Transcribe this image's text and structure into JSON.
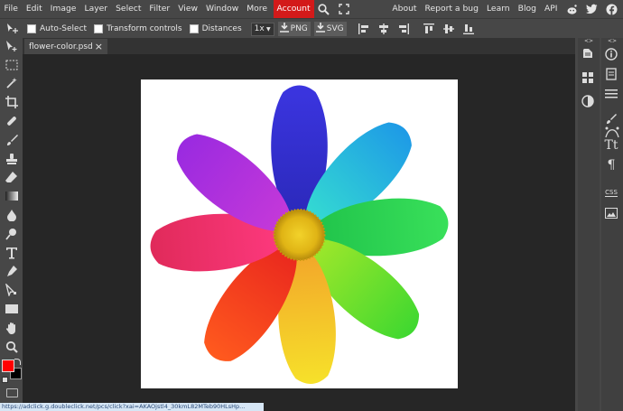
{
  "menu": {
    "items": [
      "File",
      "Edit",
      "Image",
      "Layer",
      "Select",
      "Filter",
      "View",
      "Window",
      "More"
    ],
    "account": "Account",
    "right_links": [
      "About",
      "Report a bug",
      "Learn",
      "Blog",
      "API"
    ]
  },
  "options": {
    "auto_select": "Auto-Select",
    "transform_controls": "Transform controls",
    "distances": "Distances",
    "zoom": "1x",
    "export_png": "PNG",
    "export_svg": "SVG"
  },
  "document": {
    "tab_name": "flower-color.psd",
    "close": "×"
  },
  "right_panel": {
    "col_arrows": "<>",
    "type_label": "CSS"
  },
  "status": {
    "url": "https://adclick.g.doubleclick.net/pcs/click?xai=AKAOjstl4_30kmL82MTeb90HLsHp..."
  },
  "colors": {
    "foreground": "#ff0000",
    "background": "#000000",
    "accent": "#d31a1a"
  },
  "icons": {
    "tools": [
      "move-icon",
      "marquee-icon",
      "magic-wand-icon",
      "crop-icon",
      "healing-icon",
      "brush-icon",
      "stamp-icon",
      "eraser-icon",
      "gradient-icon",
      "blur-icon",
      "dodge-icon",
      "type-icon",
      "pen-icon",
      "path-select-icon",
      "rectangle-shape-icon",
      "hand-icon",
      "zoom-icon"
    ]
  }
}
